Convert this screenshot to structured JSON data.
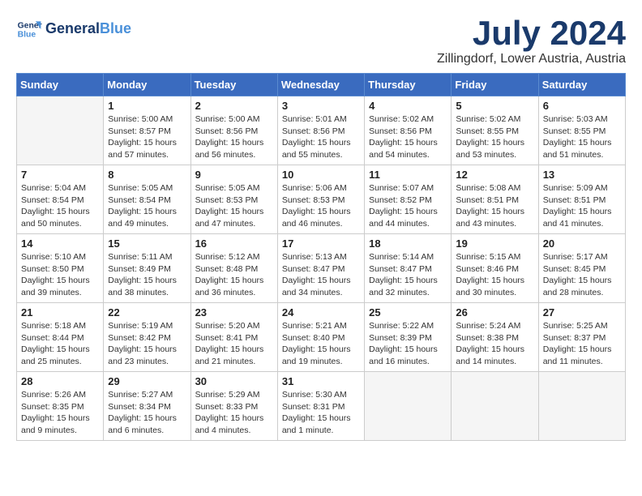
{
  "header": {
    "logo_line1": "General",
    "logo_line2": "Blue",
    "month_title": "July 2024",
    "location": "Zillingdorf, Lower Austria, Austria"
  },
  "weekdays": [
    "Sunday",
    "Monday",
    "Tuesday",
    "Wednesday",
    "Thursday",
    "Friday",
    "Saturday"
  ],
  "weeks": [
    [
      {
        "day": "",
        "info": ""
      },
      {
        "day": "1",
        "info": "Sunrise: 5:00 AM\nSunset: 8:57 PM\nDaylight: 15 hours\nand 57 minutes."
      },
      {
        "day": "2",
        "info": "Sunrise: 5:00 AM\nSunset: 8:56 PM\nDaylight: 15 hours\nand 56 minutes."
      },
      {
        "day": "3",
        "info": "Sunrise: 5:01 AM\nSunset: 8:56 PM\nDaylight: 15 hours\nand 55 minutes."
      },
      {
        "day": "4",
        "info": "Sunrise: 5:02 AM\nSunset: 8:56 PM\nDaylight: 15 hours\nand 54 minutes."
      },
      {
        "day": "5",
        "info": "Sunrise: 5:02 AM\nSunset: 8:55 PM\nDaylight: 15 hours\nand 53 minutes."
      },
      {
        "day": "6",
        "info": "Sunrise: 5:03 AM\nSunset: 8:55 PM\nDaylight: 15 hours\nand 51 minutes."
      }
    ],
    [
      {
        "day": "7",
        "info": "Sunrise: 5:04 AM\nSunset: 8:54 PM\nDaylight: 15 hours\nand 50 minutes."
      },
      {
        "day": "8",
        "info": "Sunrise: 5:05 AM\nSunset: 8:54 PM\nDaylight: 15 hours\nand 49 minutes."
      },
      {
        "day": "9",
        "info": "Sunrise: 5:05 AM\nSunset: 8:53 PM\nDaylight: 15 hours\nand 47 minutes."
      },
      {
        "day": "10",
        "info": "Sunrise: 5:06 AM\nSunset: 8:53 PM\nDaylight: 15 hours\nand 46 minutes."
      },
      {
        "day": "11",
        "info": "Sunrise: 5:07 AM\nSunset: 8:52 PM\nDaylight: 15 hours\nand 44 minutes."
      },
      {
        "day": "12",
        "info": "Sunrise: 5:08 AM\nSunset: 8:51 PM\nDaylight: 15 hours\nand 43 minutes."
      },
      {
        "day": "13",
        "info": "Sunrise: 5:09 AM\nSunset: 8:51 PM\nDaylight: 15 hours\nand 41 minutes."
      }
    ],
    [
      {
        "day": "14",
        "info": "Sunrise: 5:10 AM\nSunset: 8:50 PM\nDaylight: 15 hours\nand 39 minutes."
      },
      {
        "day": "15",
        "info": "Sunrise: 5:11 AM\nSunset: 8:49 PM\nDaylight: 15 hours\nand 38 minutes."
      },
      {
        "day": "16",
        "info": "Sunrise: 5:12 AM\nSunset: 8:48 PM\nDaylight: 15 hours\nand 36 minutes."
      },
      {
        "day": "17",
        "info": "Sunrise: 5:13 AM\nSunset: 8:47 PM\nDaylight: 15 hours\nand 34 minutes."
      },
      {
        "day": "18",
        "info": "Sunrise: 5:14 AM\nSunset: 8:47 PM\nDaylight: 15 hours\nand 32 minutes."
      },
      {
        "day": "19",
        "info": "Sunrise: 5:15 AM\nSunset: 8:46 PM\nDaylight: 15 hours\nand 30 minutes."
      },
      {
        "day": "20",
        "info": "Sunrise: 5:17 AM\nSunset: 8:45 PM\nDaylight: 15 hours\nand 28 minutes."
      }
    ],
    [
      {
        "day": "21",
        "info": "Sunrise: 5:18 AM\nSunset: 8:44 PM\nDaylight: 15 hours\nand 25 minutes."
      },
      {
        "day": "22",
        "info": "Sunrise: 5:19 AM\nSunset: 8:42 PM\nDaylight: 15 hours\nand 23 minutes."
      },
      {
        "day": "23",
        "info": "Sunrise: 5:20 AM\nSunset: 8:41 PM\nDaylight: 15 hours\nand 21 minutes."
      },
      {
        "day": "24",
        "info": "Sunrise: 5:21 AM\nSunset: 8:40 PM\nDaylight: 15 hours\nand 19 minutes."
      },
      {
        "day": "25",
        "info": "Sunrise: 5:22 AM\nSunset: 8:39 PM\nDaylight: 15 hours\nand 16 minutes."
      },
      {
        "day": "26",
        "info": "Sunrise: 5:24 AM\nSunset: 8:38 PM\nDaylight: 15 hours\nand 14 minutes."
      },
      {
        "day": "27",
        "info": "Sunrise: 5:25 AM\nSunset: 8:37 PM\nDaylight: 15 hours\nand 11 minutes."
      }
    ],
    [
      {
        "day": "28",
        "info": "Sunrise: 5:26 AM\nSunset: 8:35 PM\nDaylight: 15 hours\nand 9 minutes."
      },
      {
        "day": "29",
        "info": "Sunrise: 5:27 AM\nSunset: 8:34 PM\nDaylight: 15 hours\nand 6 minutes."
      },
      {
        "day": "30",
        "info": "Sunrise: 5:29 AM\nSunset: 8:33 PM\nDaylight: 15 hours\nand 4 minutes."
      },
      {
        "day": "31",
        "info": "Sunrise: 5:30 AM\nSunset: 8:31 PM\nDaylight: 15 hours\nand 1 minute."
      },
      {
        "day": "",
        "info": ""
      },
      {
        "day": "",
        "info": ""
      },
      {
        "day": "",
        "info": ""
      }
    ]
  ]
}
